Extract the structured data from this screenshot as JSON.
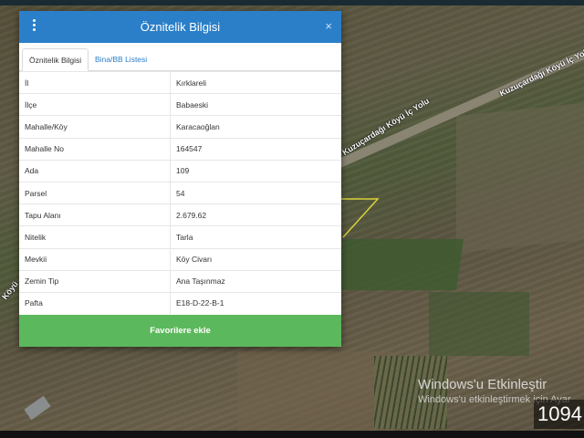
{
  "dialog": {
    "title": "Öznitelik Bilgisi",
    "close_label": "×",
    "tabs": [
      {
        "label": "Öznitelik Bilgisi",
        "active": true
      },
      {
        "label": "Bina/BB Listesi",
        "active": false
      }
    ],
    "rows": [
      {
        "key": "İl",
        "value": "Kırklareli"
      },
      {
        "key": "İlçe",
        "value": "Babaeski"
      },
      {
        "key": "Mahalle/Köy",
        "value": "Karacaoğlan"
      },
      {
        "key": "Mahalle No",
        "value": "164547"
      },
      {
        "key": "Ada",
        "value": "109"
      },
      {
        "key": "Parsel",
        "value": "54"
      },
      {
        "key": "Tapu Alanı",
        "value": "2.679.62"
      },
      {
        "key": "Nitelik",
        "value": "Tarla"
      },
      {
        "key": "Mevkii",
        "value": "Köy Civarı"
      },
      {
        "key": "Zemin Tip",
        "value": "Ana Taşınmaz"
      },
      {
        "key": "Pafta",
        "value": "E18-D-22-B-1"
      }
    ],
    "favorite_button_label": "Favorilere ekle"
  },
  "map": {
    "road_labels": [
      "Kuzuçardağı Köyü İç Yolu",
      "Kuzuçardağı Köyü İç Yolu",
      "Köyü"
    ]
  },
  "windows_activation": {
    "title": "Windows'u Etkinleştir",
    "subtitle": "Windows'u etkinleştirmek için Ayar"
  },
  "counter": "1094",
  "colors": {
    "header": "#2a7fc8",
    "button": "#5cb85c",
    "tab_link": "#2a7fc8",
    "parcel_outline": "#d8d23a"
  }
}
